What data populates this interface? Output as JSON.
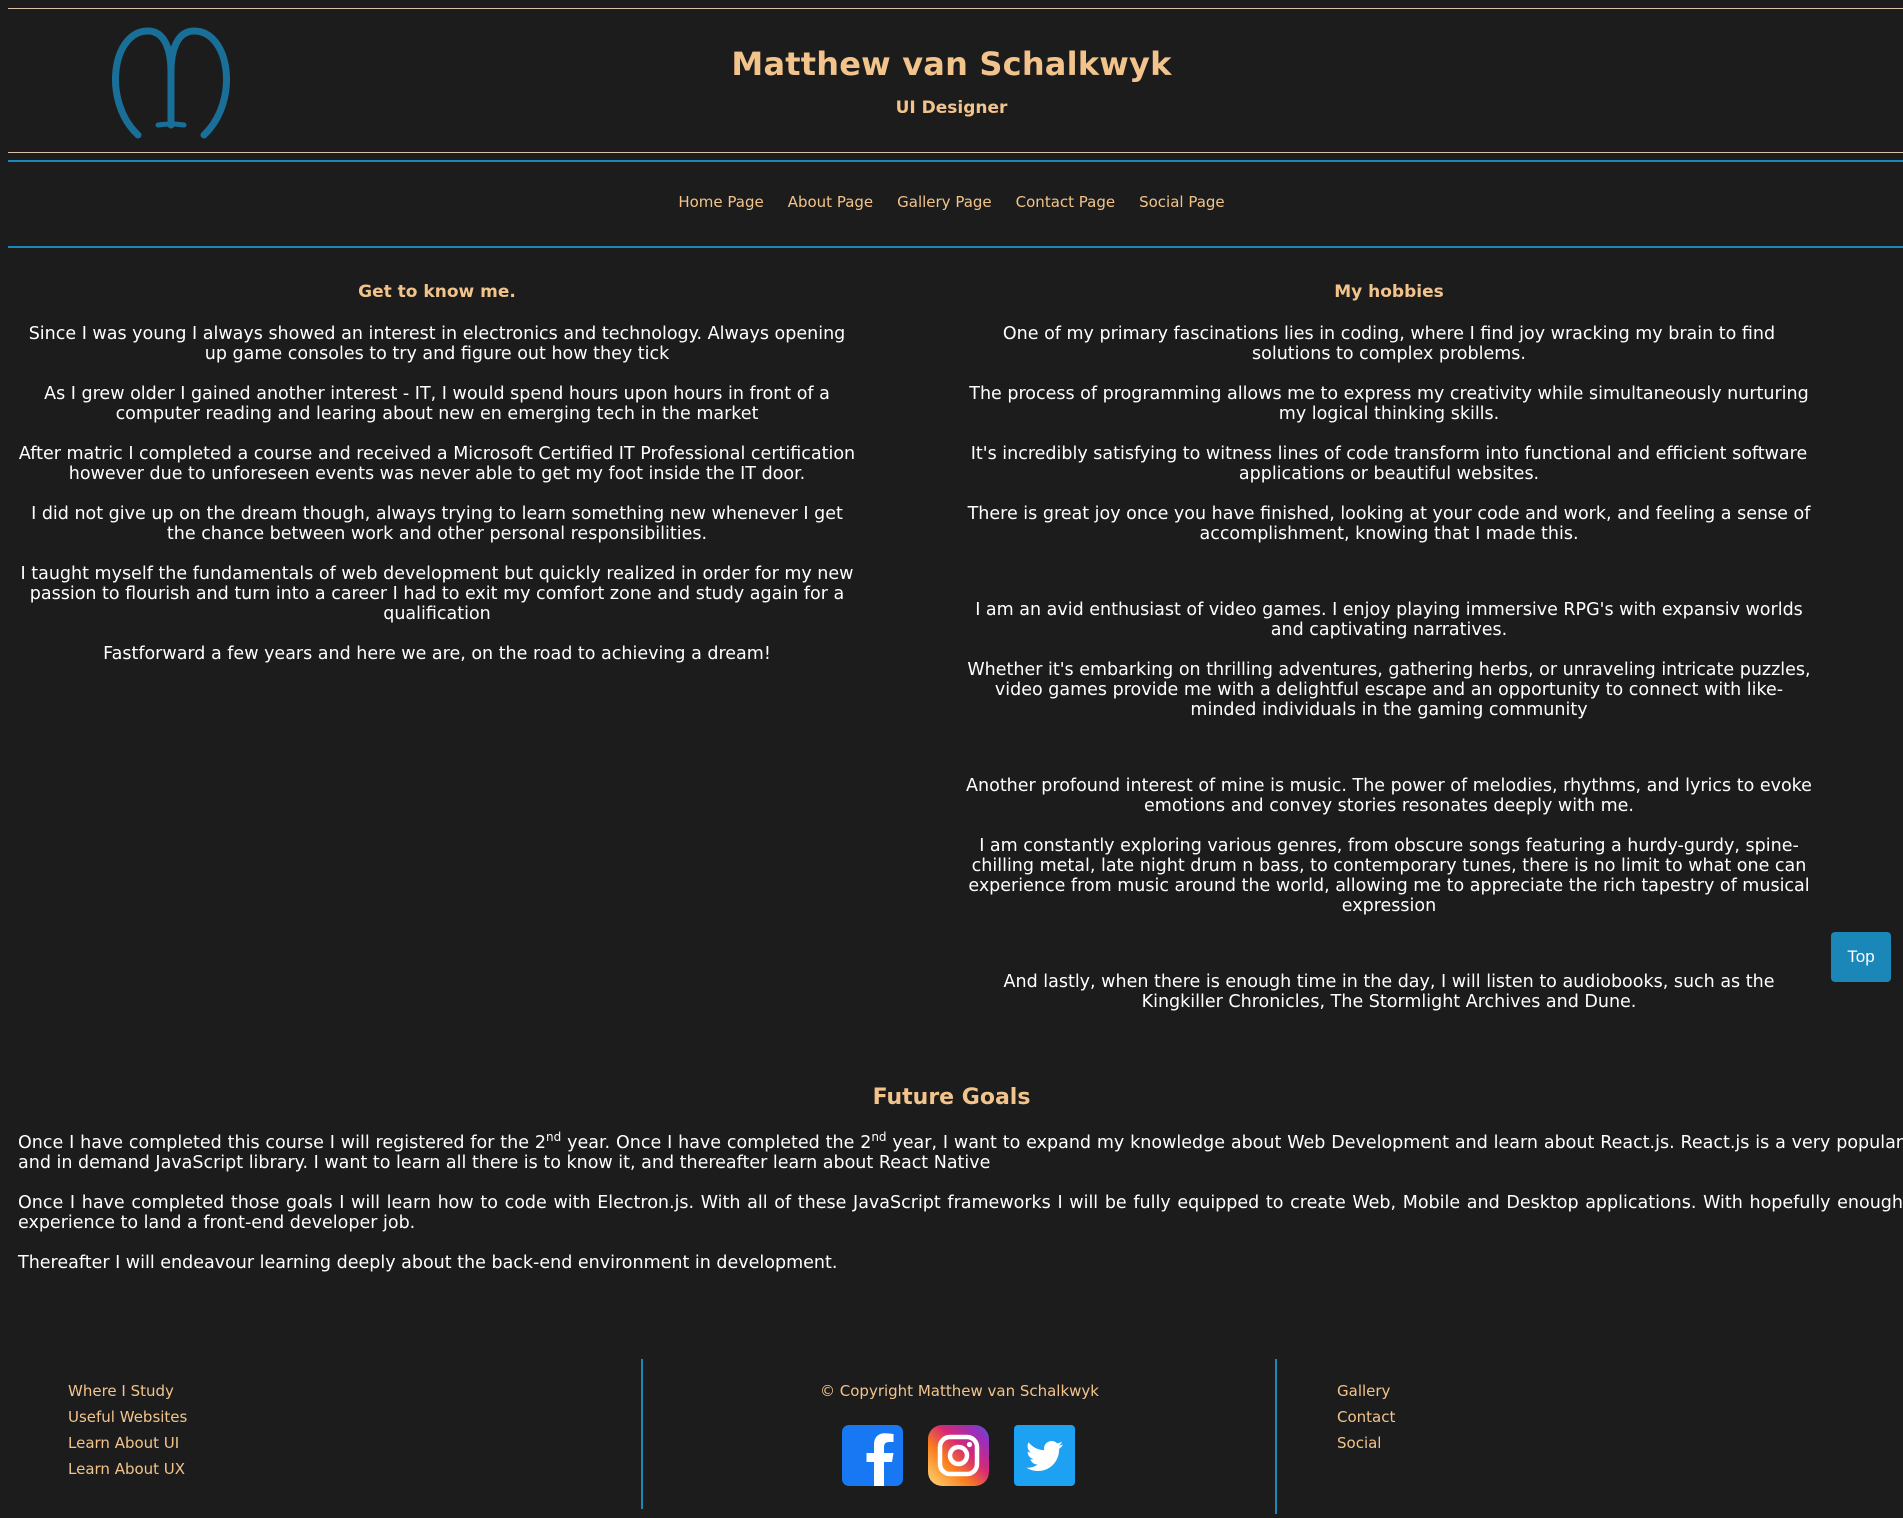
{
  "header": {
    "title": "Matthew van Schalkwyk",
    "subtitle": "UI Designer"
  },
  "nav": {
    "items": [
      "Home Page",
      "About Page",
      "Gallery Page",
      "Contact Page",
      "Social Page"
    ]
  },
  "about": {
    "heading": "Get to know me.",
    "paragraphs": [
      "Since I was young I always showed an interest in electronics and technology. Always opening up game consoles to try and figure out how they tick",
      "As I grew older I gained another interest - IT, I would spend hours upon hours in front of a computer reading and learing about new en emerging tech in the market",
      "After matric I completed a course and received a Microsoft Certified IT Professional certification however due to unforeseen events was never able to get my foot inside the IT door.",
      "I did not give up on the dream though, always trying to learn something new whenever I get the chance between work and other personal responsibilities.",
      "I taught myself the fundamentals of web development but quickly realized in order for my new passion to flourish and turn into a career I had to exit my comfort zone and study again for a qualification",
      "Fastforward a few years and here we are, on the road to achieving a dream!"
    ]
  },
  "hobbies": {
    "heading": "My hobbies",
    "paragraphs": [
      "One of my primary fascinations lies in coding, where I find joy wracking my brain to find solutions to complex problems.",
      "The process of programming allows me to express my creativity while simultaneously nurturing my logical thinking skills.",
      "It's incredibly satisfying to witness lines of code transform into functional and efficient software applications or beautiful websites.",
      "There is great joy once you have finished, looking at your code and work, and feeling a sense of accomplishment, knowing that I made this.",
      "I am an avid enthusiast of video games. I enjoy playing immersive RPG's with expansiv worlds and captivating narratives.",
      "Whether it's embarking on thrilling adventures, gathering herbs, or unraveling intricate puzzles, video games provide me with a delightful escape and an opportunity to connect with like-minded individuals in the gaming community",
      "Another profound interest of mine is music. The power of melodies, rhythms, and lyrics to evoke emotions and convey stories resonates deeply with me.",
      "I am constantly exploring various genres, from obscure songs featuring a hurdy-gurdy, spine-chilling metal, late night drum n bass, to contemporary tunes, there is no limit to what one can experience from music around the world, allowing me to appreciate the rich tapestry of musical expression",
      "And lastly, when there is enough time in the day, I will listen to audiobooks, such as the Kingkiller Chronicles, The Stormlight Archives and Dune."
    ]
  },
  "goals": {
    "heading": "Future Goals",
    "p1_a": "Once I have completed this course I will registered for the 2",
    "p1_sup1": "nd",
    "p1_b": " year. Once I have completed the 2",
    "p1_sup2": "nd",
    "p1_c": " year, I want to expand my knowledge about Web Development and learn about React.js. React.js is a very popular and in demand JavaScript library. I want to learn all there is to know it, and thereafter learn about React Native",
    "p2": "Once I have completed those goals I will learn how to code with Electron.js. With all of these JavaScript frameworks I will be fully equipped to create Web, Mobile and Desktop applications. With hopefully enough experience to land a front-end developer job.",
    "p3": "Thereafter I will endeavour learning deeply about the back-end environment in development."
  },
  "top_button": {
    "label": "Top"
  },
  "footer": {
    "left_links": [
      "Where I Study",
      "Useful Websites",
      "Learn About UI",
      "Learn About UX"
    ],
    "copyright": "© Copyright Matthew van Schalkwyk",
    "right_links": [
      "Gallery",
      "Contact",
      "Social"
    ],
    "social_icons": [
      "facebook-icon",
      "instagram-icon",
      "twitter-icon"
    ]
  },
  "colors": {
    "background": "#1c1c1c",
    "accent_gold": "#f2c48c",
    "accent_blue": "#1b87b8",
    "text": "#ffffff"
  }
}
